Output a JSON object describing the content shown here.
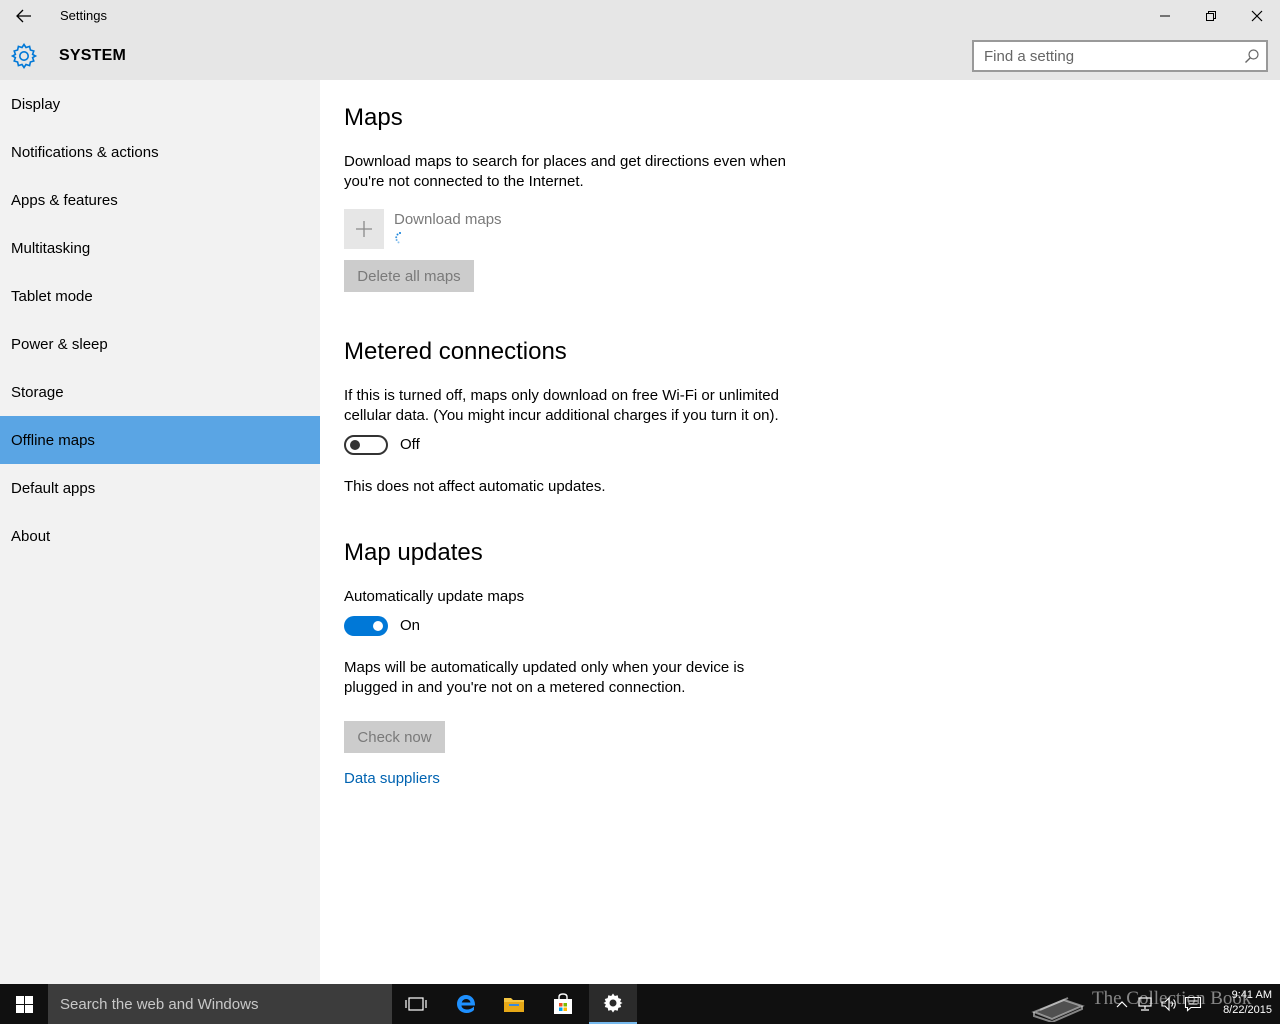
{
  "window": {
    "title": "Settings",
    "section": "SYSTEM",
    "search_placeholder": "Find a setting"
  },
  "sidebar": {
    "items": [
      {
        "label": "Display"
      },
      {
        "label": "Notifications & actions"
      },
      {
        "label": "Apps & features"
      },
      {
        "label": "Multitasking"
      },
      {
        "label": "Tablet mode"
      },
      {
        "label": "Power & sleep"
      },
      {
        "label": "Storage"
      },
      {
        "label": "Offline maps",
        "selected": true
      },
      {
        "label": "Default apps"
      },
      {
        "label": "About"
      }
    ]
  },
  "main": {
    "maps": {
      "heading": "Maps",
      "description": "Download maps to search for places and get directions even when you're not connected to the Internet.",
      "download_label": "Download maps",
      "delete_button": "Delete all maps"
    },
    "metered": {
      "heading": "Metered connections",
      "description": "If this is turned off, maps only download on free Wi-Fi or unlimited cellular data. (You might incur additional charges if you turn it on).",
      "toggle_state": "Off",
      "toggle_on": false,
      "note": "This does not affect automatic updates."
    },
    "updates": {
      "heading": "Map updates",
      "auto_label": "Automatically update maps",
      "toggle_state": "On",
      "toggle_on": true,
      "description": "Maps will be automatically updated only when your device is plugged in and you're not on a metered connection.",
      "check_button": "Check now",
      "data_suppliers_link": "Data suppliers"
    }
  },
  "taskbar": {
    "search_placeholder": "Search the web and Windows",
    "time": "9:41 AM",
    "date": "8/22/2015",
    "watermark": "The Collection Book"
  },
  "colors": {
    "accent": "#0078d7",
    "selected_nav": "#5aa5e4",
    "link": "#0063b1",
    "sidebar_bg": "#f2f2f2",
    "header_bg": "#e6e6e6",
    "taskbar_bg": "#101010"
  }
}
